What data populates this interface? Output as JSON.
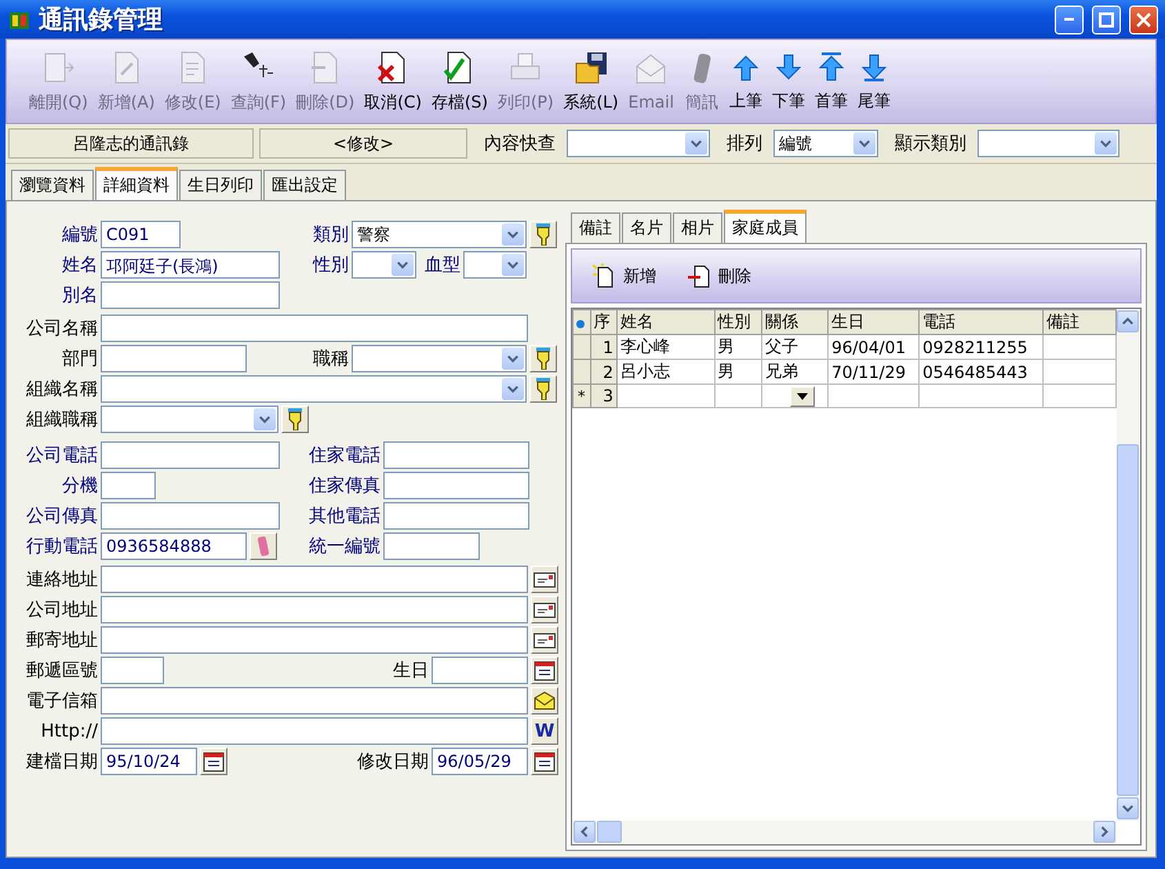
{
  "window": {
    "title": "通訊錄管理"
  },
  "toolbar": [
    {
      "label": "離開(Q)",
      "disabled": true
    },
    {
      "label": "新增(A)",
      "disabled": true
    },
    {
      "label": "修改(E)",
      "disabled": true
    },
    {
      "label": "查詢(F)",
      "disabled": true
    },
    {
      "label": "刪除(D)",
      "disabled": true
    },
    {
      "label": "取消(C)",
      "disabled": false
    },
    {
      "label": "存檔(S)",
      "disabled": false
    },
    {
      "label": "列印(P)",
      "disabled": true
    },
    {
      "label": "系統(L)",
      "disabled": false
    },
    {
      "label": "Email",
      "disabled": true
    },
    {
      "label": "簡訊",
      "disabled": true
    },
    {
      "label": "上筆",
      "disabled": false
    },
    {
      "label": "下筆",
      "disabled": false
    },
    {
      "label": "首筆",
      "disabled": false
    },
    {
      "label": "尾筆",
      "disabled": false
    }
  ],
  "info_bar": {
    "book": "呂隆志的通訊錄",
    "mode": "<修改>",
    "filters": [
      {
        "label": "內容快查"
      },
      {
        "label": "排列",
        "value": "編號"
      },
      {
        "label": "顯示類別"
      }
    ]
  },
  "tabs": [
    {
      "label": "瀏覽資料",
      "selected": false
    },
    {
      "label": "詳細資料",
      "selected": true
    },
    {
      "label": "生日列印",
      "selected": false
    },
    {
      "label": "匯出設定",
      "selected": false
    }
  ],
  "form": [
    [
      {
        "label": "編號",
        "color": "#00007f",
        "kind": "text",
        "value": "C091"
      },
      {
        "label": "類別",
        "color": "#00007f",
        "kind": "combo",
        "value": "警察",
        "button": {
          "kind": "pick"
        }
      }
    ],
    [
      {
        "label": "姓名",
        "color": "#00007f",
        "kind": "text",
        "value": "邛阿廷子(長鴻)"
      },
      {
        "label": "性別",
        "color": "#00007f",
        "kind": "combo"
      },
      {
        "label": "血型",
        "color": "#00007f",
        "kind": "combo"
      }
    ],
    [
      {
        "label": "別名",
        "color": "#00007f",
        "kind": "text"
      }
    ],
    [
      {
        "label": "公司名稱",
        "color": "#000000",
        "kind": "text"
      }
    ],
    [
      {
        "label": "部門",
        "color": "#000000",
        "kind": "text"
      },
      {
        "label": "職稱",
        "color": "#000000",
        "kind": "combo",
        "button": {
          "kind": "pick"
        }
      }
    ],
    [
      {
        "label": "組織名稱",
        "color": "#000000",
        "kind": "combo",
        "button": {
          "kind": "pick"
        }
      }
    ],
    [
      {
        "label": "組織職稱",
        "color": "#000000",
        "kind": "combo",
        "button": {
          "kind": "pick"
        }
      }
    ],
    [
      {
        "label": "公司電話",
        "color": "#00007f",
        "kind": "text"
      },
      {
        "label": "住家電話",
        "color": "#00007f",
        "kind": "text"
      }
    ],
    [
      {
        "label": "分機",
        "color": "#00007f",
        "kind": "text"
      },
      {
        "label": "住家傳真",
        "color": "#00007f",
        "kind": "text"
      }
    ],
    [
      {
        "label": "公司傳真",
        "color": "#00007f",
        "kind": "text"
      },
      {
        "label": "其他電話",
        "color": "#00007f",
        "kind": "text"
      }
    ],
    [
      {
        "label": "行動電話",
        "color": "#00007f",
        "kind": "text",
        "value": "0936584888",
        "button": {
          "kind": "dial"
        }
      },
      {
        "label": "統一編號",
        "color": "#00007f",
        "kind": "text"
      }
    ],
    [
      {
        "label": "連絡地址",
        "color": "#000000",
        "kind": "text",
        "button": {
          "kind": "address"
        }
      }
    ],
    [
      {
        "label": "公司地址",
        "color": "#000000",
        "kind": "text",
        "button": {
          "kind": "address"
        }
      }
    ],
    [
      {
        "label": "郵寄地址",
        "color": "#000000",
        "kind": "text",
        "button": {
          "kind": "address"
        }
      }
    ],
    [
      {
        "label": "郵遞區號",
        "color": "#000000",
        "kind": "text"
      },
      {
        "label": "生日",
        "color": "#000000",
        "kind": "text",
        "button": {
          "kind": "date"
        }
      }
    ],
    [
      {
        "label": "電子信箱",
        "color": "#000000",
        "kind": "text",
        "button": {
          "kind": "email"
        }
      }
    ],
    [
      {
        "label": "Http://",
        "color": "#000000",
        "kind": "text",
        "button": {
          "kind": "web",
          "text": "W"
        }
      }
    ],
    [
      {
        "label": "建檔日期",
        "color": "#000000",
        "kind": "text",
        "value": "95/10/24",
        "button": {
          "kind": "date"
        }
      },
      {
        "label": "修改日期",
        "color": "#000000",
        "kind": "text",
        "value": "96/05/29",
        "button": {
          "kind": "date"
        }
      }
    ]
  ],
  "detail_tabs": [
    {
      "label": "備註",
      "selected": false
    },
    {
      "label": "名片",
      "selected": false
    },
    {
      "label": "相片",
      "selected": false
    },
    {
      "label": "家庭成員",
      "selected": true
    }
  ],
  "family": {
    "toolbar": [
      {
        "label": "新增"
      },
      {
        "label": "刪除"
      }
    ],
    "columns": [
      "序",
      "姓名",
      "性別",
      "關係",
      "生日",
      "電話",
      "備註"
    ],
    "rows": [
      {
        "cells": [
          "1",
          "李心峰",
          "男",
          "父子",
          "96/04/01",
          "0928211255"
        ],
        "editing": false
      },
      {
        "cells": [
          "2",
          "呂小志",
          "男",
          "兄弟",
          "70/11/29",
          "0546485443"
        ],
        "editing": false
      },
      {
        "marker": "*",
        "cells": [
          "3"
        ],
        "editing": true
      }
    ]
  }
}
